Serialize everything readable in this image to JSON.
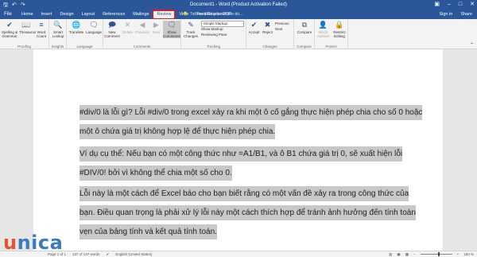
{
  "window": {
    "title": "Document1 - Word (Product Activation Failed)",
    "quick_access": [
      "save-icon",
      "undo-icon",
      "redo-icon"
    ],
    "controls": [
      "minimize-icon",
      "restore-icon",
      "close-icon"
    ]
  },
  "menu": {
    "file": "File",
    "tabs": [
      "Home",
      "Insert",
      "Design",
      "Layout",
      "References",
      "Mailings",
      "Review",
      "View",
      "Foxit Reader PDF"
    ],
    "active_tab": "Review",
    "tell_me": "Tell me what you want to do...",
    "right": [
      "Sign in",
      "Share"
    ]
  },
  "ribbon": {
    "proofing": {
      "label": "Proofing",
      "spelling": "Spelling & Grammar",
      "thesaurus": "Thesaurus",
      "word_count": "Word Count"
    },
    "insights": {
      "label": "Insights",
      "smart_lookup": "Smart Lookup"
    },
    "language": {
      "label": "Language",
      "translate": "Translate",
      "language": "Language"
    },
    "comments": {
      "label": "Comments",
      "new": "New Comment",
      "delete": "Delete",
      "previous": "Previous",
      "next": "Next",
      "show": "Show Comments"
    },
    "tracking": {
      "label": "Tracking",
      "track_changes": "Track Changes",
      "simple_markup": "Simple Markup",
      "show_markup": "Show Markup",
      "reviewing_pane": "Reviewing Pane"
    },
    "changes": {
      "label": "Changes",
      "accept": "Accept",
      "reject": "Reject",
      "previous": "Previous",
      "next": "Next"
    },
    "compare": {
      "label": "Compare",
      "compare": "Compare"
    },
    "protect": {
      "label": "Protect",
      "block_authors": "Block Authors",
      "restrict_editing": "Restrict Editing"
    }
  },
  "document": {
    "paragraphs": [
      "#div/0 là lỗi gì? Lỗi #div/0 trong excel xảy ra khi một ô cố gắng thực hiện phép chia cho số 0 hoặc một ô chứa giá trị không hợp lệ để thực hiện phép chia.",
      "Ví dụ cụ thể: Nếu bạn có một công thức như =A1/B1, và ô B1 chứa giá trị 0, sẽ xuất hiện lỗi #DIV/0! bởi vì không thể chia một số cho 0.",
      "Lỗi này là một cách để Excel báo cho bạn biết rằng có một vấn đề xảy ra trong công thức của bạn. Điều quan trọng là phải xử lý lỗi này một cách thích hợp để tránh ảnh hưởng đến tính toàn vẹn của bảng tính và kết quả tính toán."
    ]
  },
  "status": {
    "page": "Page 1 of 1",
    "words": "137 of 137 words",
    "language": "English (United States)",
    "zoom": "150 %",
    "zoom_fraction": 0.6
  },
  "logo": {
    "text_u": "u",
    "text_rest": "nica"
  }
}
